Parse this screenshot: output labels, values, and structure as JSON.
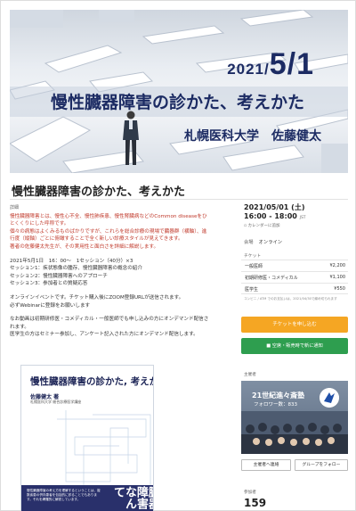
{
  "hero": {
    "date_prefix": "2021/",
    "date_big": "5/1",
    "title": "慢性臓器障害の診かた、考えかた",
    "subtitle": "札幌医科大学　佐藤健太"
  },
  "event": {
    "title": "慢性臓器障害の診かた、考えかた"
  },
  "article": {
    "section_label": "詳細",
    "intro_lines": [
      "慢性臓器障害とは、慢性心不全、慢性肺疾患、慢性腎臓病などのCommon diseaseをひ",
      "とくくりにした呼称です。",
      "個々の病態はよくみるものばかりですが、これらを総合診療の現場で臓器群（横軸）、進",
      "行度（縦軸）ごとに俯瞰することで全く新しい診療スタイルが見えてきます。",
      "著者の佐藤健太先生が、その実用性と面白さを詳細に解説します。"
    ],
    "schedule_lines": [
      "2021年5月1日　16：00～　1セッション（40分）×3",
      "セッション1：疾状態像の腫存、慢性臓器障害の概念の紹介",
      "セッション2：慢性臓器障害へのアプローチ",
      "セッション3：参加者との質疑応答"
    ],
    "online_lines": [
      "オンラインイベントです。チケット購入後にZOOM登録URLが送信されます。",
      "必ずWebinarに登録をお願いします"
    ],
    "extra_lines": [
      "なお動画は初期研修医・コメディカル・一般医師でも申し込みの方にオンデマンド配信さ",
      "れます。",
      "医学生の方はセミナー参加し、アンケート記入された方にオンデマンド配信します。"
    ]
  },
  "book": {
    "title": "慢性臓器障害の診かた, 考えかた",
    "author": "佐藤健太 著",
    "affiliation": "札幌医科大学 総合診療医学講座",
    "band_text": "慢性臓器障害の考え方を理解するということは、複数疾患の併存患者を包括的に診ることでもあります。それを網羅的に解説しています。",
    "big_text": "慢性臓器障害なんて"
  },
  "sidebar": {
    "date": "2021/05/01 (土)",
    "time": "16:00 - 18:00",
    "tz": "JST",
    "calendar_link": "カレンダーに追加",
    "venue_key": "会場",
    "venue": "オンライン",
    "ticket_label": "チケット",
    "tickets": [
      {
        "name": "一般医師",
        "price": "¥2,200"
      },
      {
        "name": "初期研修医・コメディカル",
        "price": "¥1,100"
      },
      {
        "name": "医学生",
        "price": "¥550"
      }
    ],
    "note": "コンビニ / ATM でのお支払いは、2021/04/30で締め切られます",
    "buy_button": "チケットを申し込む",
    "notify_button": "■ 空席・販売時で新に通知",
    "organizer_label": "主催者",
    "organizer_name": "21世紀進々斎塾",
    "followers": "フォロワー数：833",
    "contact_button": "主催者へ連絡",
    "follow_button": "グループをフォロー",
    "participants_label": "参加者",
    "participants": "159"
  }
}
